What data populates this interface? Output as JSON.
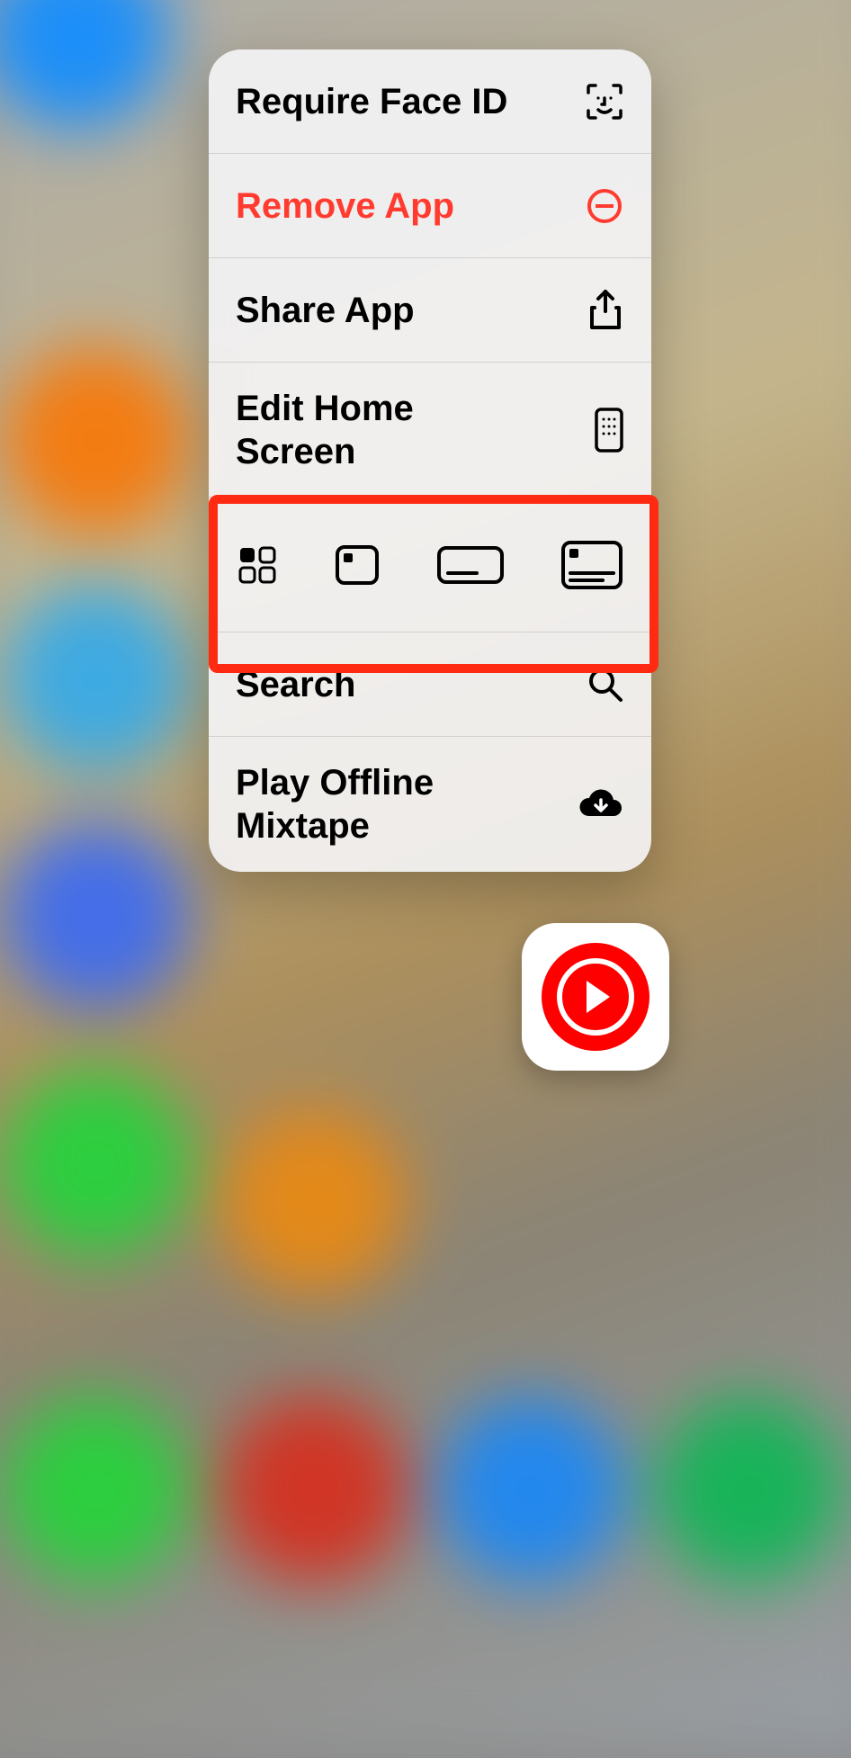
{
  "menu": {
    "items": [
      {
        "label": "Require Face ID",
        "icon": "face-id-icon",
        "destructive": false
      },
      {
        "label": "Remove App",
        "icon": "remove-icon",
        "destructive": true
      },
      {
        "label": "Share App",
        "icon": "share-icon",
        "destructive": false
      },
      {
        "label": "Edit Home Screen",
        "icon": "phone-grid-icon",
        "destructive": false
      }
    ],
    "widget_options": [
      {
        "name": "widget-icon-grid",
        "icon": "icon-grid-small"
      },
      {
        "name": "widget-small-card",
        "icon": "card-small"
      },
      {
        "name": "widget-wide-card",
        "icon": "card-wide"
      },
      {
        "name": "widget-large-card",
        "icon": "card-large"
      }
    ],
    "footer_items": [
      {
        "label": "Search",
        "icon": "search-icon"
      },
      {
        "label": "Play Offline Mixtape",
        "icon": "cloud-download-icon"
      }
    ],
    "colors": {
      "destructive": "#ff3b30",
      "highlight": "#ff2a12",
      "app_accent": "#ff0000"
    }
  },
  "app": {
    "name": "YouTube Music"
  }
}
